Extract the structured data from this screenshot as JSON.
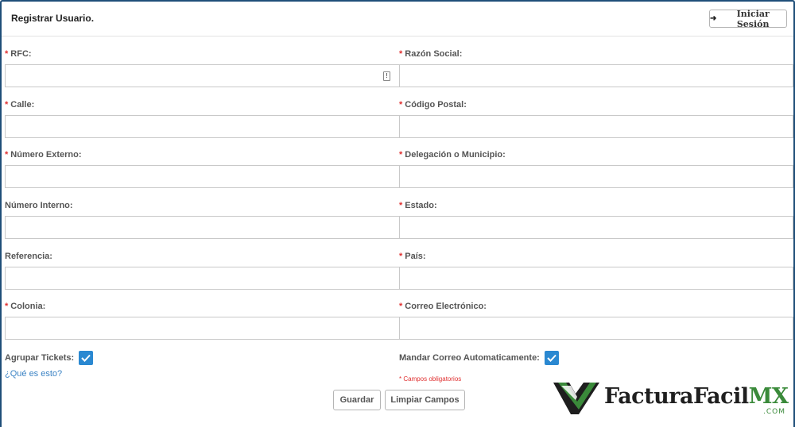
{
  "header": {
    "title": "Registrar Usuario.",
    "login_button": "Iniciar Sesión",
    "login_icon": "sign-in-icon"
  },
  "required_mark": "*",
  "fields": {
    "rfc": {
      "label": "RFC:",
      "value": ""
    },
    "razon_social": {
      "label": "Razón Social:",
      "value": ""
    },
    "calle": {
      "label": "Calle:",
      "value": ""
    },
    "codigo_postal": {
      "label": "Código Postal:",
      "value": ""
    },
    "numero_externo": {
      "label": "Número Externo:",
      "value": ""
    },
    "delegacion": {
      "label": "Delegación o Municipio:",
      "value": ""
    },
    "numero_interno": {
      "label": "Número Interno:",
      "value": ""
    },
    "estado": {
      "label": "Estado:",
      "value": ""
    },
    "referencia": {
      "label": "Referencia:",
      "value": ""
    },
    "pais": {
      "label": "País:",
      "value": ""
    },
    "colonia": {
      "label": "Colonia:",
      "value": ""
    },
    "correo": {
      "label": "Correo Electrónico:",
      "value": ""
    }
  },
  "options": {
    "agrupar_tickets": {
      "label": "Agrupar Tickets:",
      "checked": true
    },
    "mandar_correo": {
      "label": "Mandar Correo Automaticamente:",
      "checked": true
    },
    "help_link": "¿Qué es esto?"
  },
  "required_note": "* Campos obligatorios",
  "buttons": {
    "save": "Guardar",
    "clear": "Limpiar Campos"
  },
  "logo": {
    "name_main": "FacturaFacil",
    "name_suffix": "MX",
    "domain": ".COM"
  },
  "colors": {
    "accent": "#2a88d1",
    "required": "#e03030",
    "link": "#3b83c4",
    "logo_green": "#3a8a3a"
  }
}
